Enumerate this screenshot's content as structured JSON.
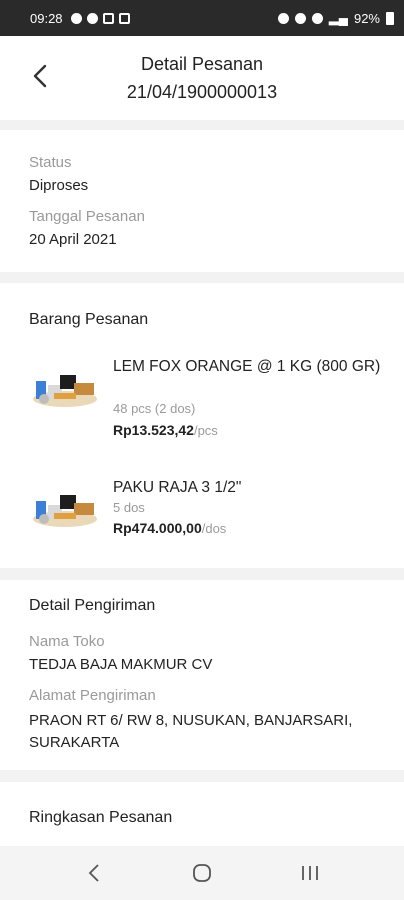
{
  "statusbar": {
    "time": "09:28",
    "battery": "92%"
  },
  "header": {
    "title_line1": "Detail Pesanan",
    "title_line2": "21/04/1900000013"
  },
  "status_section": {
    "status_label": "Status",
    "status_value": "Diproses",
    "date_label": "Tanggal Pesanan",
    "date_value": "20 April 2021"
  },
  "items_section": {
    "title": "Barang Pesanan",
    "items": [
      {
        "name": "LEM FOX ORANGE @ 1 KG (800 GR)",
        "qty": "48 pcs (2 dos)",
        "price": "Rp13.523,42",
        "unit": "/pcs"
      },
      {
        "name": "PAKU RAJA 3 1/2\"",
        "qty": "5 dos",
        "price": "Rp474.000,00",
        "unit": "/dos"
      }
    ]
  },
  "shipping_section": {
    "title": "Detail Pengiriman",
    "store_label": "Nama Toko",
    "store_value": "TEDJA BAJA MAKMUR CV",
    "address_label": "Alamat Pengiriman",
    "address_value": "PRAON RT 6/ RW 8, NUSUKAN, BANJARSARI, SURAKARTA"
  },
  "summary_section": {
    "title": "Ringkasan Pesanan"
  },
  "icons": {
    "back": "chevron-left-icon",
    "nav_back": "nav-back-icon",
    "nav_home": "nav-home-icon",
    "nav_recents": "nav-recents-icon"
  }
}
